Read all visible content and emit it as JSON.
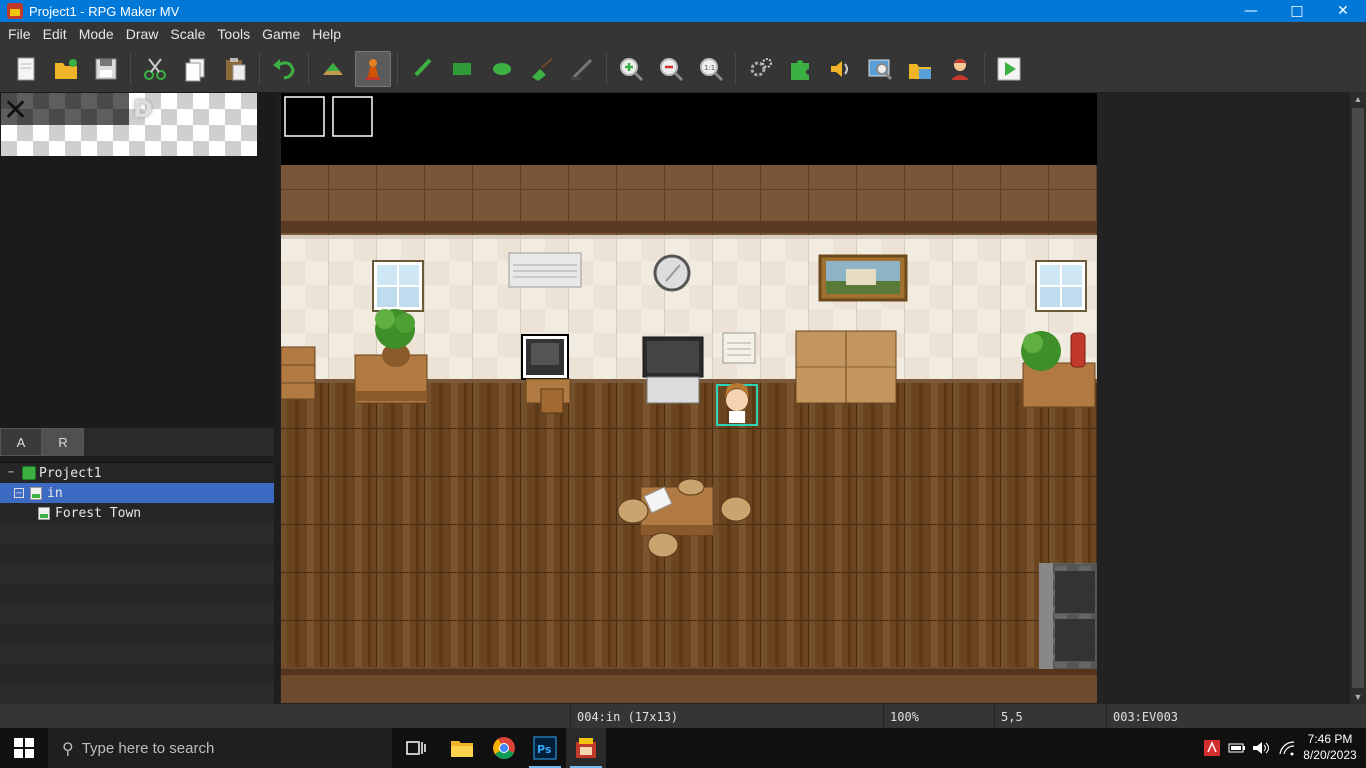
{
  "window": {
    "title": "Project1 - RPG Maker MV"
  },
  "menu": [
    "File",
    "Edit",
    "Mode",
    "Draw",
    "Scale",
    "Tools",
    "Game",
    "Help"
  ],
  "palette_tabs": [
    "A",
    "R"
  ],
  "tree": {
    "root": "Project1",
    "maps": [
      "in",
      "Forest Town"
    ]
  },
  "status": {
    "map_info": "004:in (17x13)",
    "zoom": "100%",
    "coords": "5,5",
    "event": "003:EV003"
  },
  "taskbar": {
    "search_placeholder": "Type here to search",
    "time": "7:46 PM",
    "date": "8/20/2023"
  }
}
